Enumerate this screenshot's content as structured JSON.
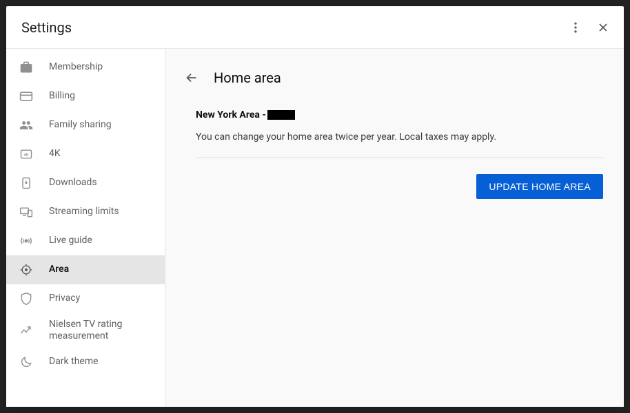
{
  "header": {
    "title": "Settings"
  },
  "sidebar": {
    "items": [
      {
        "label": "Membership"
      },
      {
        "label": "Billing"
      },
      {
        "label": "Family sharing"
      },
      {
        "label": "4K"
      },
      {
        "label": "Downloads"
      },
      {
        "label": "Streaming limits"
      },
      {
        "label": "Live guide"
      },
      {
        "label": "Area"
      },
      {
        "label": "Privacy"
      },
      {
        "label": "Nielsen TV rating measurement"
      },
      {
        "label": "Dark theme"
      }
    ]
  },
  "content": {
    "title": "Home area",
    "area_prefix": "New York Area - ",
    "description": "You can change your home area twice per year. Local taxes may apply.",
    "update_button": "Update Home Area"
  }
}
